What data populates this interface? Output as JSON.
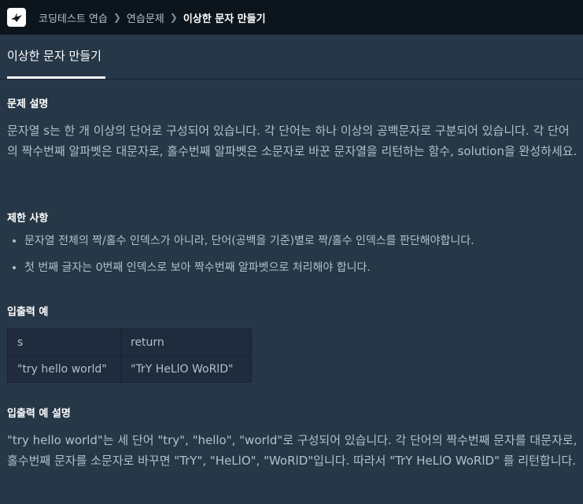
{
  "breadcrumb": {
    "items": [
      "코딩테스트 연습",
      "연습문제",
      "이상한 문자 만들기"
    ]
  },
  "tab": {
    "label": "이상한 문자 만들기"
  },
  "sections": {
    "description_title": "문제 설명",
    "description_text": "문자열 s는 한 개 이상의 단어로 구성되어 있습니다. 각 단어는 하나 이상의 공백문자로 구분되어 있습니다. 각 단어의 짝수번째 알파벳은 대문자로, 홀수번째 알파벳은 소문자로 바꾼 문자열을 리턴하는 함수, solution을 완성하세요.",
    "constraints_title": "제한 사항",
    "constraints": [
      "문자열 전체의 짝/홀수 인덱스가 아니라, 단어(공백을 기준)별로 짝/홀수 인덱스를 판단해야합니다.",
      "첫 번째 글자는 0번째 인덱스로 보아 짝수번째 알파벳으로 처리해야 합니다."
    ],
    "io_title": "입출력 예",
    "io_table": {
      "headers": [
        "s",
        "return"
      ],
      "rows": [
        [
          "\"try hello world\"",
          "\"TrY HeLlO WoRlD\""
        ]
      ]
    },
    "io_explain_title": "입출력 예 설명",
    "io_explain_text": "\"try hello world\"는 세 단어 \"try\", \"hello\", \"world\"로 구성되어 있습니다. 각 단어의 짝수번째 문자를 대문자로, 홀수번째 문자를 소문자로 바꾸면 \"TrY\", \"HeLlO\", \"WoRlD\"입니다. 따라서 \"TrY HeLlO WoRlD\" 를 리턴합니다."
  },
  "icons": {
    "logo": "bird-logo-icon",
    "separator": "chevron-right-icon"
  },
  "colors": {
    "background": "#263747",
    "topbar": "#0c151c",
    "text": "#b2c0cc",
    "heading": "#ffffff"
  }
}
